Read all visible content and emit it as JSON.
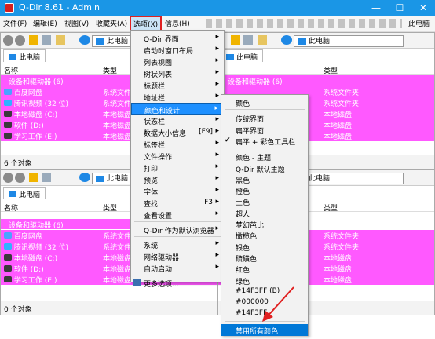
{
  "window": {
    "title": "Q-Dir 8.61 - Admin",
    "min": "—",
    "max": "☐",
    "close": "✕"
  },
  "menubar": {
    "file": "文件(F)",
    "edit": "编辑(E)",
    "view": "视图(V)",
    "favorites": "收藏夹(A)",
    "options": "选项(X)",
    "info": "信息(H)",
    "right": "此电脑"
  },
  "address": "此电脑",
  "tab_label": "此电脑",
  "columns": {
    "name": "名称",
    "type": "类型"
  },
  "group_top": "设备和驱动器 (6)",
  "group_bottom": "设备和驱动器 (6)",
  "rows": [
    {
      "name": "百度网盘",
      "type": "系统文件夹"
    },
    {
      "name": "腾讯视频 (32 位)",
      "type": "系统文件夹"
    },
    {
      "name": "本地磁盘 (C:)",
      "type": "本地磁盘"
    },
    {
      "name": "软件 (D:)",
      "type": "本地磁盘"
    },
    {
      "name": "学习工作 (E:)",
      "type": "本地磁盘"
    }
  ],
  "status": {
    "top_left": "6 个对象",
    "bottom_left": "0 个对象"
  },
  "options_menu": {
    "items": [
      {
        "label": "Q-Dir 界面",
        "arrow": "▸"
      },
      {
        "label": "启动时窗口布局",
        "arrow": "▸"
      },
      {
        "label": "列表视图",
        "arrow": "▸"
      },
      {
        "label": "树状列表",
        "arrow": "▸"
      },
      {
        "label": "标题栏",
        "arrow": "▸"
      },
      {
        "label": "地址栏",
        "arrow": "▸"
      },
      {
        "label": "颜色和设计",
        "arrow": "▸"
      },
      {
        "label": "状态栏",
        "arrow": "▸"
      },
      {
        "label": "数据大小信息",
        "shortcut": "[F9]",
        "arrow": "▸"
      },
      {
        "label": "标签栏",
        "arrow": "▸"
      },
      {
        "label": "文件操作",
        "arrow": "▸"
      },
      {
        "label": "打印",
        "arrow": "▸"
      },
      {
        "label": "预览",
        "arrow": "▸"
      },
      {
        "label": "字体",
        "arrow": "▸"
      },
      {
        "label": "查找",
        "shortcut": "F3",
        "arrow": "▸"
      },
      {
        "label": "查看设置",
        "arrow": "▸"
      },
      {
        "label": "Q-Dir 作为默认浏览器",
        "arrow": "▸"
      },
      {
        "label": "系统",
        "arrow": "▸"
      },
      {
        "label": "网络驱动器",
        "arrow": "▸"
      },
      {
        "label": "自动启动",
        "arrow": "▸"
      },
      {
        "label": "更多选项..."
      }
    ]
  },
  "color_menu": {
    "items": [
      "颜色",
      "传统界面",
      "扁平界面",
      "扁平 + 彩色工具栏",
      "颜色 - 主题",
      "Q-Dir 默认主题",
      "黑色",
      "橙色",
      "土色",
      "超人",
      "梦幻芭比",
      "橄榄色",
      "银色",
      "硫磺色",
      "红色",
      "绿色",
      "#14F3FF (B)",
      "#000000",
      "#14F3FF",
      "禁用所有颜色"
    ],
    "checked": "扁平 + 彩色工具栏",
    "checkmark": "✔"
  },
  "colors": {
    "accent": "#1a96e6",
    "highlight": "#0078d7",
    "magenta": "#ff59ff",
    "annotation_red": "#e02020"
  }
}
